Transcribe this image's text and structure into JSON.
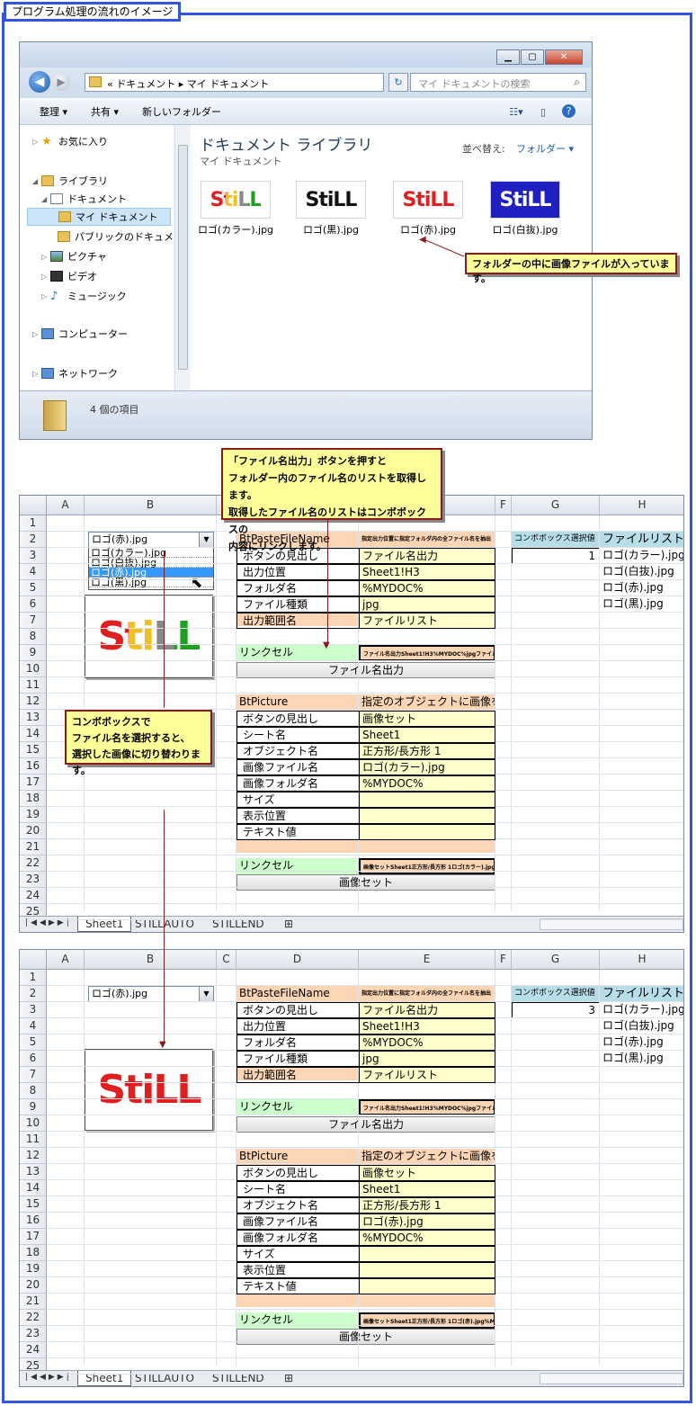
{
  "frame_title": "プログラム処理の流れのイメージ",
  "explorer": {
    "address": "« ドキュメント ▸ マイ ドキュメント",
    "search_placeholder": "マイ ドキュメントの検索",
    "toolbar": {
      "organize": "整理 ▾",
      "share": "共有 ▾",
      "new_folder": "新しいフォルダー"
    },
    "nav": {
      "favorites": "お気に入り",
      "libraries": "ライブラリ",
      "documents": "ドキュメント",
      "my_documents": "マイ ドキュメント",
      "public_documents": "パブリックのドキュメ",
      "pictures": "ピクチャ",
      "videos": "ビデオ",
      "music": "ミュージック",
      "computer": "コンピューター",
      "network": "ネットワーク"
    },
    "library_title": "ドキュメント ライブラリ",
    "library_sub": "マイ ドキュメント",
    "sort_label": "並べ替え:",
    "sort_value": "フォルダー ▾",
    "files": [
      {
        "name": "ロゴ(カラー).jpg",
        "logo": "StiLL"
      },
      {
        "name": "ロゴ(黒).jpg",
        "logo": "StiLL"
      },
      {
        "name": "ロゴ(赤).jpg",
        "logo": "StiLL"
      },
      {
        "name": "ロゴ(白抜).jpg",
        "logo": "StiLL"
      }
    ],
    "status": "4 個の項目"
  },
  "callouts": {
    "folder_note": "フォルダーの中に画像ファイルが入っています。",
    "button_note_1": "「ファイル名出力」ボタンを押すと",
    "button_note_2": "フォルダー内のファイル名のリストを取得します。",
    "button_note_3": "取得したファイル名のリストはコンボボックスの",
    "button_note_4": "内容にリンクします。",
    "combo_note_1": "コンボボックスで",
    "combo_note_2": "ファイル名を選択すると、",
    "combo_note_3": "選択した画像に切り替わります。"
  },
  "sheet": {
    "columns": [
      "A",
      "B",
      "C",
      "D",
      "E",
      "F",
      "G",
      "H"
    ],
    "rows": [
      "1",
      "2",
      "3",
      "4",
      "5",
      "6",
      "7",
      "8",
      "9",
      "10",
      "11",
      "12",
      "13",
      "14",
      "15",
      "16",
      "17",
      "18",
      "19",
      "20",
      "21",
      "22",
      "23",
      "24",
      "25"
    ],
    "paste": {
      "header": "BtPasteFileName",
      "header_desc": "指定出力位置に指定フォルダ内の全ファイル名を抽出",
      "labels": [
        "ボタンの見出し",
        "出力位置",
        "フォルダ名",
        "ファイル種類",
        "出力範囲名"
      ],
      "values": [
        "ファイル名出力",
        "Sheet1!H3",
        "%MYDOC%",
        "jpg",
        "ファイルリスト"
      ],
      "link_label": "リンクセル",
      "link_value": "ファイル名出力Sheet1!H3%MYDOC%jpgファイルリスト",
      "button": "ファイル名出力"
    },
    "picture": {
      "header": "BtPicture",
      "header_desc": "指定のオブジェクトに画像をセット",
      "labels": [
        "ボタンの見出し",
        "シート名",
        "オブジェクト名",
        "画像ファイル名",
        "画像フォルダ名",
        "サイズ",
        "表示位置",
        "テキスト値"
      ],
      "link_label": "リンクセル",
      "button": "画像セット"
    },
    "combo_header": "コンボボックス選択値",
    "list_header": "ファイルリスト",
    "file_list": [
      "ロゴ(カラー).jpg",
      "ロゴ(白抜).jpg",
      "ロゴ(赤).jpg",
      "ロゴ(黒).jpg"
    ],
    "tabs": [
      "Sheet1",
      "STILLAUTO",
      "STILLEND"
    ]
  },
  "sheet1": {
    "combo_value": "ロゴ(赤).jpg",
    "dropdown_items": [
      "ロゴ(カラー).jpg",
      "ロゴ(白抜).jpg",
      "ロゴ(赤).jpg",
      "ロゴ(黒).jpg"
    ],
    "combo_index": "1",
    "picture_values": [
      "画像セット",
      "Sheet1",
      "正方形/長方形 1",
      "ロゴ(カラー).jpg",
      "%MYDOC%",
      "",
      "",
      ""
    ],
    "picture_link_value": "画像セットSheet1正方形/長方形 1ロゴ(カラー).jpg%MYDOC%",
    "logo": "StiLL"
  },
  "sheet2": {
    "combo_value": "ロゴ(赤).jpg",
    "combo_index": "3",
    "picture_values": [
      "画像セット",
      "Sheet1",
      "正方形/長方形 1",
      "ロゴ(赤).jpg",
      "%MYDOC%",
      "",
      "",
      ""
    ],
    "picture_link_value": "画像セットSheet1正方形/長方形 1ロゴ(赤).jpg%MYDOC%",
    "logo": "StiLL"
  },
  "colors": {
    "frame": "#3355dd",
    "callout_bg": "#ffff99",
    "callout_border": "#8b1a1a",
    "peach": "#fcd5b4",
    "yellow": "#ffffcc",
    "green": "#ccffcc",
    "blue": "#b7dee8"
  }
}
